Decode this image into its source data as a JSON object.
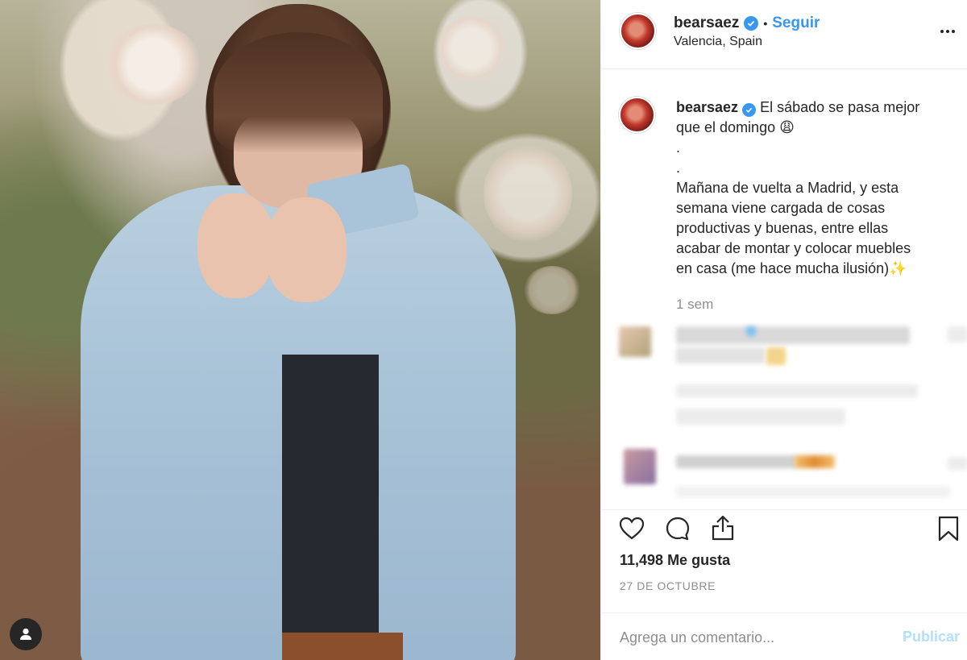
{
  "post": {
    "username": "bearsaez",
    "follow_label": "Seguir",
    "separator": "•",
    "location": "Valencia, Spain"
  },
  "caption": {
    "username": "bearsaez",
    "lines": [
      "El sábado se pasa mejor",
      "que el domingo 😩",
      ".",
      ".",
      "Mañana de vuelta a Madrid, y esta",
      "semana viene cargada de cosas",
      "productivas y buenas, entre ellas",
      "acabar de montar y colocar muebles",
      "en casa (me hace mucha ilusión)✨"
    ],
    "time": "1 sem"
  },
  "actions": {
    "likes": "11,498 Me gusta",
    "date": "27 DE OCTUBRE"
  },
  "comment": {
    "placeholder": "Agrega un comentario...",
    "publish_label": "Publicar"
  },
  "icons": {
    "verified": "verified-badge-icon",
    "more": "more-options-icon",
    "like": "heart-icon",
    "comment": "comment-bubble-icon",
    "share": "share-icon",
    "save": "bookmark-icon",
    "profile": "user-icon"
  },
  "colors": {
    "accent": "#3897f0",
    "publish_disabled": "#b2dffc",
    "muted": "#8e8e8e",
    "text": "#262626"
  }
}
